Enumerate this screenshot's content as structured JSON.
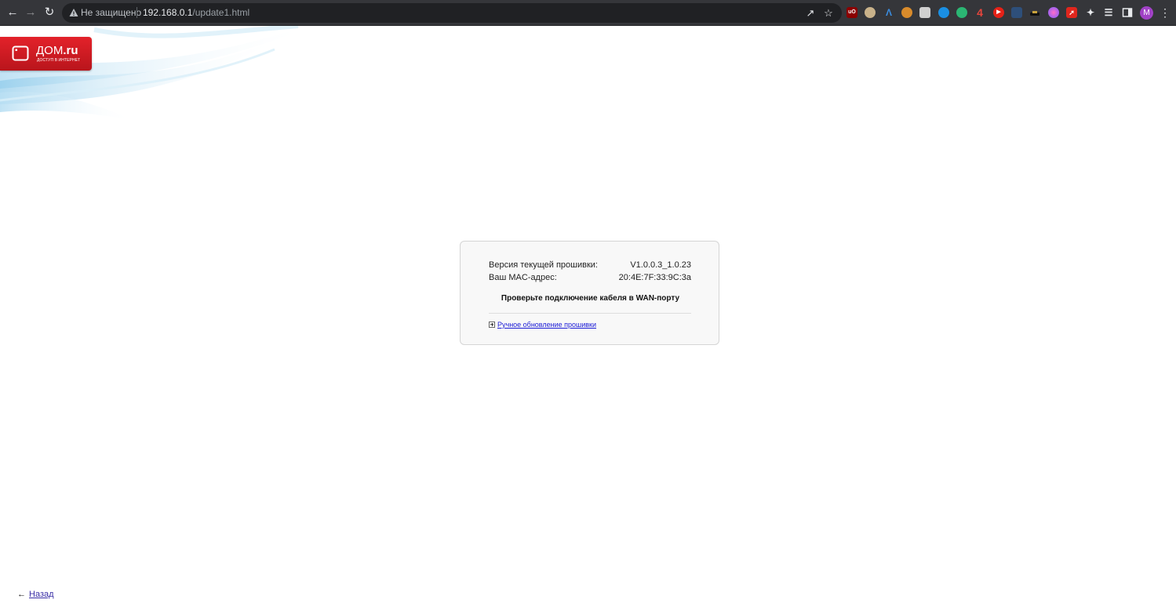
{
  "browser": {
    "security_label": "Не защищено",
    "url_host": "192.168.0.1",
    "url_path": "/update1.html",
    "profile_initial": "M",
    "extension_badge_text": "4",
    "extensions": [
      "ublock-icon",
      "face-icon",
      "triangle-icon",
      "cookie-icon",
      "mask-icon",
      "s-circle-icon",
      "globe-icon",
      "number-four-icon",
      "youtube-icon",
      "screen-icon",
      "car-icon",
      "color-circle-icon",
      "red-arrow-icon",
      "puzzle-icon"
    ]
  },
  "logo": {
    "brand_prefix": "ДОМ",
    "brand_suffix": ".ru",
    "tagline": "ДОСТУП В ИНТЕРНЕТ",
    "color": "#e3222a"
  },
  "firmware": {
    "version_label": "Версия текущей прошивки:",
    "version_value": "V1.0.0.3_1.0.23",
    "mac_label": "Ваш MAC-адрес:",
    "mac_value": "20:4E:7F:33:9C:3a",
    "message": "Проверьте подключение кабеля в WAN-порту",
    "manual_update_link": "Ручное обновление прошивки"
  },
  "footer": {
    "back_arrow": "←",
    "back_link": "Назад"
  }
}
